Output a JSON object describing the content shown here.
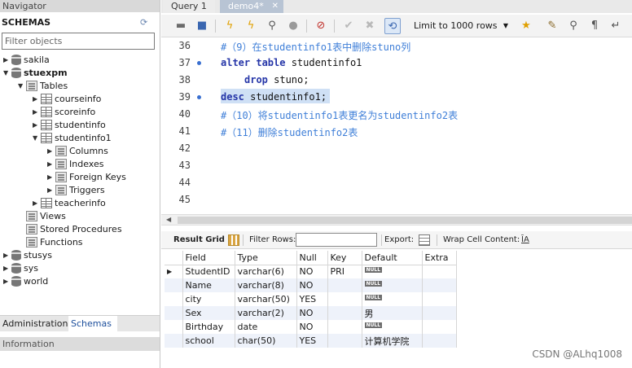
{
  "navigator": {
    "title": "Navigator",
    "schemas_label": "SCHEMAS",
    "filter_placeholder": "Filter objects",
    "tree": [
      {
        "label": "sakila"
      },
      {
        "label": "stuexpm"
      },
      {
        "label": "Tables"
      },
      {
        "label": "courseinfo"
      },
      {
        "label": "scoreinfo"
      },
      {
        "label": "studentinfo"
      },
      {
        "label": "studentinfo1"
      },
      {
        "label": "Columns"
      },
      {
        "label": "Indexes"
      },
      {
        "label": "Foreign Keys"
      },
      {
        "label": "Triggers"
      },
      {
        "label": "teacherinfo"
      },
      {
        "label": "Views"
      },
      {
        "label": "Stored Procedures"
      },
      {
        "label": "Functions"
      },
      {
        "label": "stusys"
      },
      {
        "label": "sys"
      },
      {
        "label": "world"
      }
    ],
    "tabs": {
      "administration": "Administration",
      "schemas": "Schemas"
    },
    "info_label": "Information"
  },
  "query_tabs": [
    {
      "label": "Query 1"
    },
    {
      "label": "demo4*"
    }
  ],
  "toolbar": {
    "limit_label": "Limit to 1000 rows"
  },
  "editor": {
    "lines": [
      {
        "n": "36",
        "text": "#（9）在studentinfo1表中删除stuno列"
      },
      {
        "n": "37",
        "kw1": "alter table",
        "rest": " studentinfo1"
      },
      {
        "n": "38",
        "kw1": "drop",
        "rest": " stuno;"
      },
      {
        "n": "39",
        "kw1": "desc",
        "rest": " studentinfo1;"
      },
      {
        "n": "40",
        "text": "#（10）将studentinfo1表更名为studentinfo2表"
      },
      {
        "n": "41",
        "text": "#（11）删除studentinfo2表"
      },
      {
        "n": "42"
      },
      {
        "n": "43"
      },
      {
        "n": "44"
      },
      {
        "n": "45"
      }
    ]
  },
  "result_toolbar": {
    "result_grid": "Result Grid",
    "filter_rows": "Filter Rows:",
    "export": "Export:",
    "wrap_cell": "Wrap Cell Content:"
  },
  "grid": {
    "columns": [
      "Field",
      "Type",
      "Null",
      "Key",
      "Default",
      "Extra"
    ],
    "rows": [
      {
        "field": "StudentID",
        "type": "varchar(6)",
        "null": "NO",
        "key": "PRI",
        "default_null": "NULL",
        "default": "",
        "extra": ""
      },
      {
        "field": "Name",
        "type": "varchar(8)",
        "null": "NO",
        "key": "",
        "default_null": "NULL",
        "default": "",
        "extra": ""
      },
      {
        "field": "city",
        "type": "varchar(50)",
        "null": "YES",
        "key": "",
        "default_null": "NULL",
        "default": "",
        "extra": ""
      },
      {
        "field": "Sex",
        "type": "varchar(2)",
        "null": "NO",
        "key": "",
        "default_null": "",
        "default": "男",
        "extra": ""
      },
      {
        "field": "Birthday",
        "type": "date",
        "null": "NO",
        "key": "",
        "default_null": "NULL",
        "default": "",
        "extra": ""
      },
      {
        "field": "school",
        "type": "char(50)",
        "null": "YES",
        "key": "",
        "default_null": "",
        "default": "计算机学院",
        "extra": ""
      }
    ]
  },
  "watermark": "CSDN @ALhq1008",
  "colors": {
    "accent": "#1d4f9c",
    "keyword": "#2636a8",
    "comment": "#3f7fd8",
    "highlight": "#cfe0f5"
  }
}
